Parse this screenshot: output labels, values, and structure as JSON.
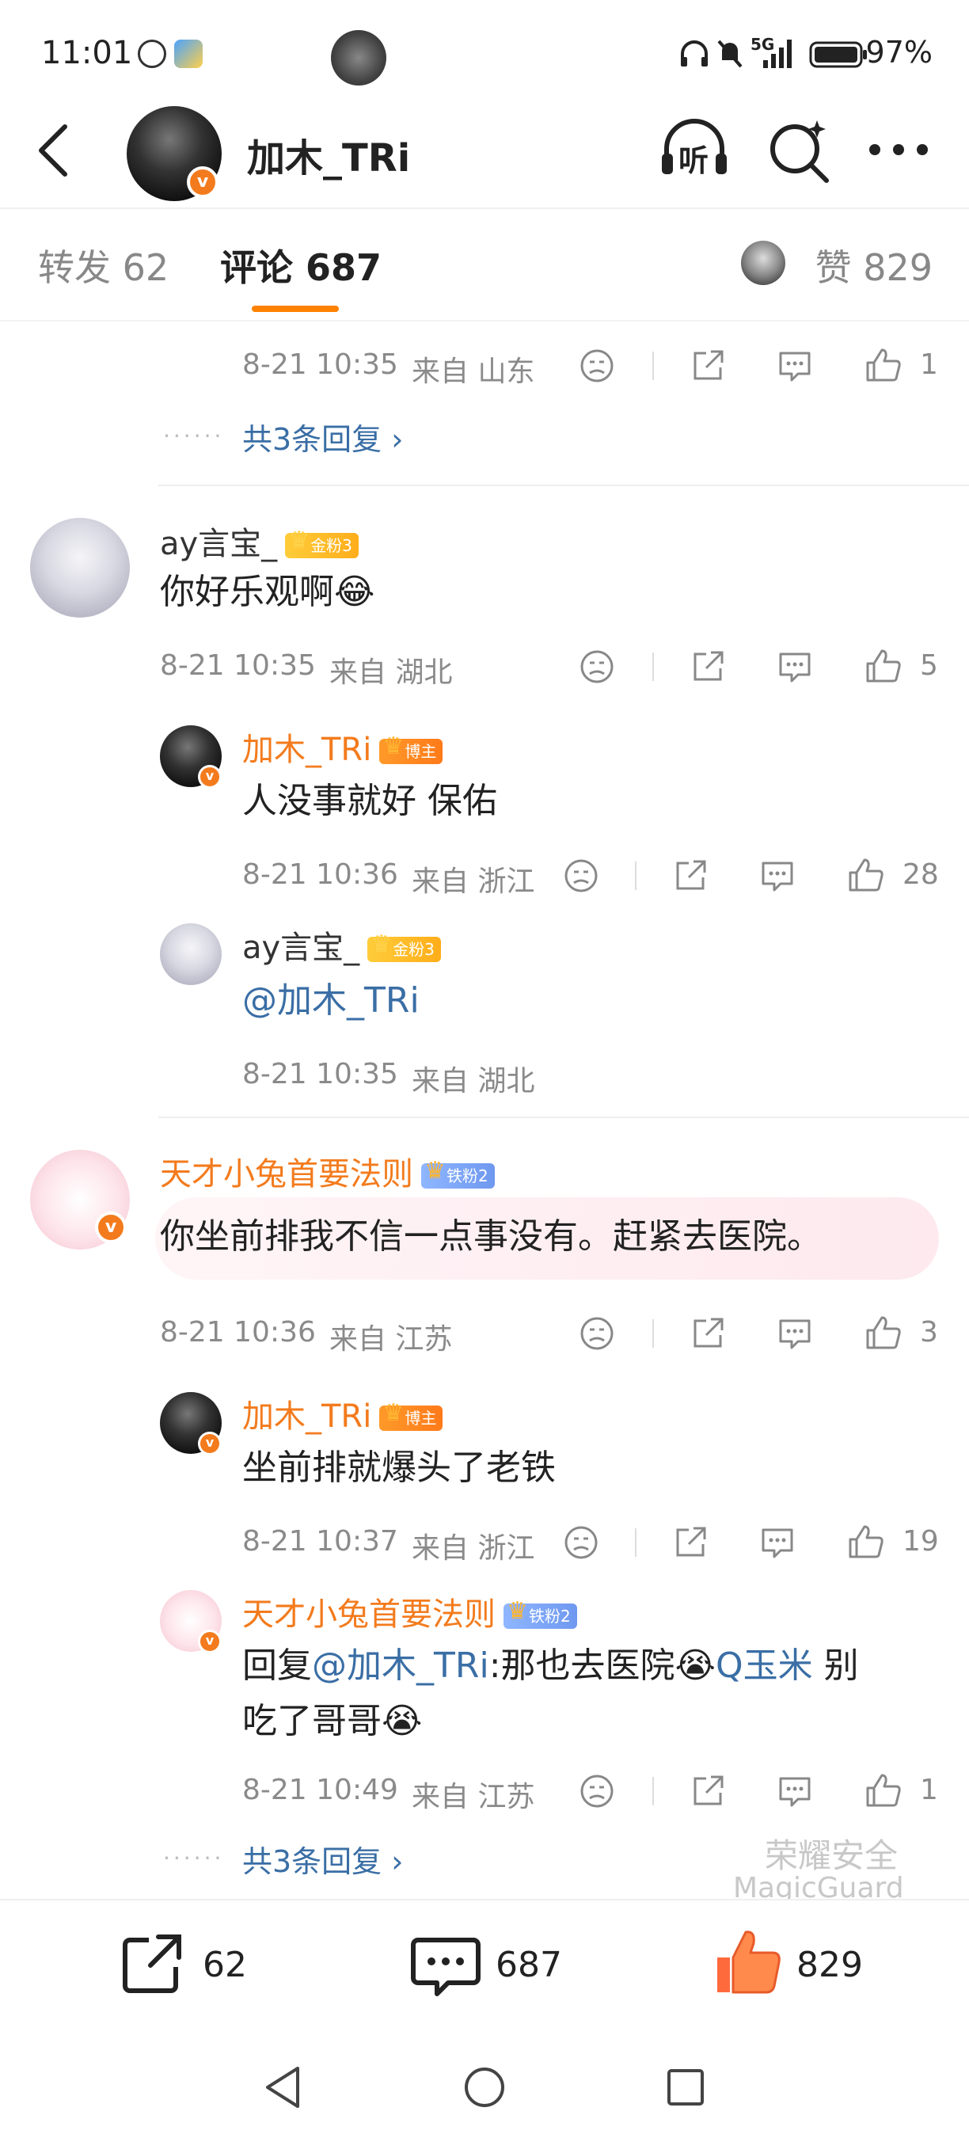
{
  "status_bar": {
    "time": "11:01",
    "network": "5G",
    "battery": "97%"
  },
  "header": {
    "title": "加木_TRi",
    "verified_badge": "v",
    "listen_label": "听"
  },
  "tabs": {
    "repost": "转发 62",
    "comment": "评论 687",
    "like": "赞 829"
  },
  "top_partial": {
    "time": "8-21 10:35",
    "location": "来自 山东",
    "likes": "1",
    "more_replies": "共3条回复 ›"
  },
  "comments": [
    {
      "user": "ay言宝_",
      "badge": "金粉3",
      "text": "你好乐观啊😂",
      "time": "8-21 10:35",
      "location": "来自 湖北",
      "likes": "5",
      "replies": [
        {
          "user": "加木_TRi",
          "badge": "博主",
          "text": "人没事就好 保佑",
          "time": "8-21 10:36",
          "location": "来自 浙江",
          "likes": "28"
        },
        {
          "user": "ay言宝_",
          "badge": "金粉3",
          "text": "@加木_TRi",
          "time": "8-21 10:35",
          "location": "来自 湖北"
        }
      ]
    },
    {
      "user": "天才小兔首要法则",
      "badge": "铁粉2",
      "text": "你坐前排我不信一点事没有。赶紧去医院。",
      "time": "8-21 10:36",
      "location": "来自 江苏",
      "likes": "3",
      "replies": [
        {
          "user": "加木_TRi",
          "badge": "博主",
          "text": "坐前排就爆头了老铁",
          "time": "8-21 10:37",
          "location": "来自 浙江",
          "likes": "19"
        },
        {
          "user": "天才小兔首要法则",
          "badge": "铁粉2",
          "text_prefix": "回复",
          "mention": "@加木_TRi",
          "text_mid": ":那也去医院😭",
          "topic": "Q玉米",
          "text_end": " 别",
          "text_line2": "吃了哥哥😭",
          "time": "8-21 10:49",
          "location": "来自 江苏",
          "likes": "1"
        }
      ],
      "more_replies": "共3条回复 ›"
    }
  ],
  "watermark": {
    "line1": "荣耀安全",
    "line2": "MagicGuard"
  },
  "bottom_bar": {
    "repost_count": "62",
    "comment_count": "687",
    "like_count": "829"
  },
  "colors": {
    "accent": "#ff8200",
    "link": "#3a6ea5",
    "username_orange": "#f37b1d",
    "meta": "#8a8a8a"
  }
}
